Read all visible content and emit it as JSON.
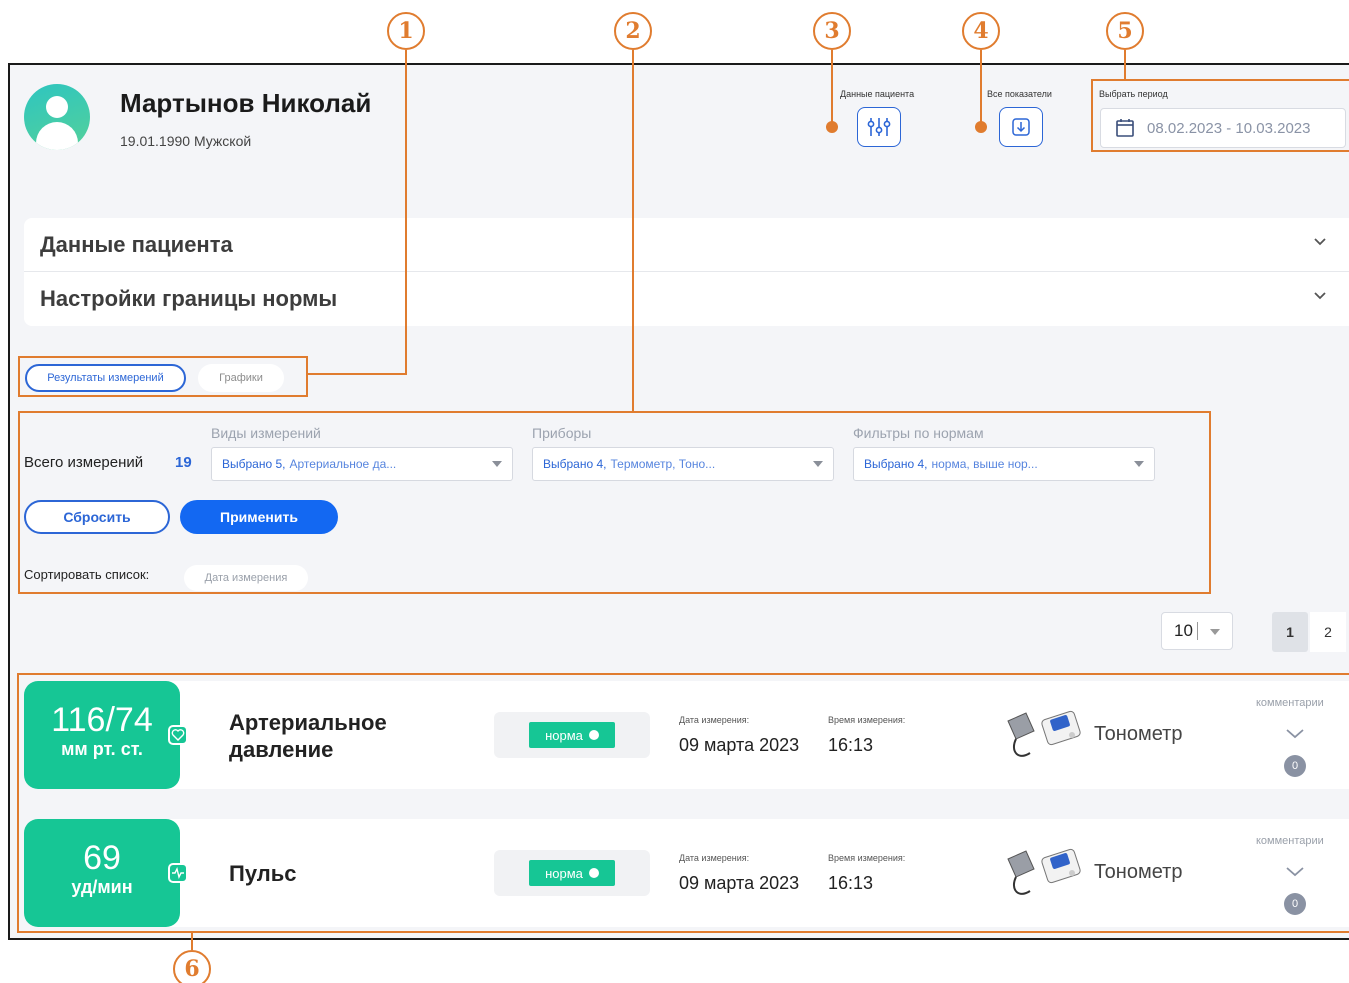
{
  "callouts": [
    "1",
    "2",
    "3",
    "4",
    "5",
    "6"
  ],
  "patient": {
    "name": "Мартынов Николай",
    "info": "19.01.1990 Мужской"
  },
  "header": {
    "patient_data_label": "Данные пациента",
    "all_indicators_label": "Все показатели",
    "period_label": "Выбрать период",
    "period_value": "08.02.2023 - 10.03.2023"
  },
  "accordions": [
    {
      "title": "Данные пациента"
    },
    {
      "title": "Настройки границы нормы"
    }
  ],
  "tabs": [
    {
      "label": "Результаты измерений",
      "active": true
    },
    {
      "label": "Графики",
      "active": false
    }
  ],
  "filters": {
    "total_label": "Всего измерений",
    "total_count": "19",
    "types": {
      "label": "Виды измерений",
      "count": "Выбрано 5,",
      "rest": "Артериальное да..."
    },
    "devices": {
      "label": "Приборы",
      "count": "Выбрано 4,",
      "rest": "Термометр, Тоно..."
    },
    "norms": {
      "label": "Фильтры по нормам",
      "count": "Выбрано 4,",
      "rest": "норма, выше нор..."
    },
    "reset_label": "Сбросить",
    "apply_label": "Применить",
    "sort_label": "Сортировать список:",
    "sort_chip": "Дата измерения"
  },
  "pagination": {
    "per_page": "10",
    "pages": [
      "1",
      "2"
    ],
    "current": "1"
  },
  "measurements": [
    {
      "value": "116/74",
      "unit": "мм рт. ст.",
      "type_line1": "Артериальное",
      "type_line2": "давление",
      "status": "норма",
      "date_label": "Дата измерения:",
      "date": "09 марта 2023",
      "time_label": "Время измерения:",
      "time": "16:13",
      "device": "Тонометр",
      "comments_label": "комментарии",
      "comments_count": "0"
    },
    {
      "value": "69",
      "unit": "уд/мин",
      "type_line1": "Пульс",
      "type_line2": "",
      "status": "норма",
      "date_label": "Дата измерения:",
      "date": "09 марта 2023",
      "time_label": "Время измерения:",
      "time": "16:13",
      "device": "Тонометр",
      "comments_label": "комментарии",
      "comments_count": "0"
    }
  ],
  "colors": {
    "accent": "#2c66d6",
    "primary_button": "#1368f2",
    "success": "#16c695",
    "annotation": "#e07c2f"
  }
}
